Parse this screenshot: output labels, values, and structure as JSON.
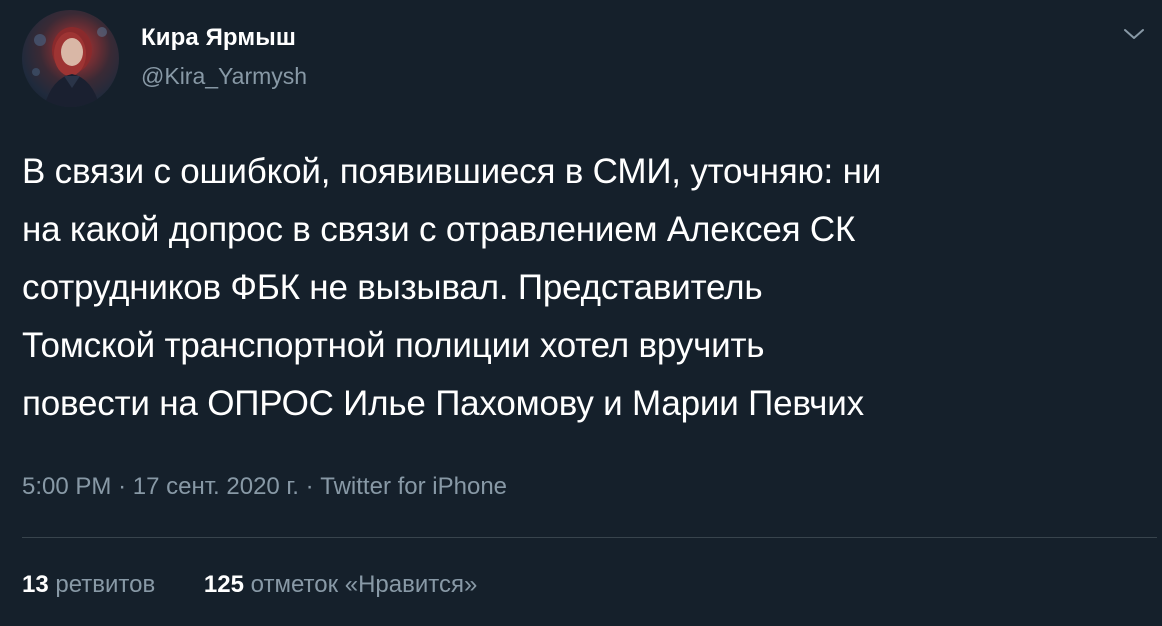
{
  "author": {
    "name": "Кира Ярмыш",
    "handle": "@Kira_Yarmysh"
  },
  "tweet": {
    "text": "В связи с ошибкой, появившиеся в СМИ, уточняю: ни\nна какой допрос в связи с отравлением Алексея СК\nсотрудников ФБК не вызывал. Представитель\nТомской транспортной полиции хотел вручить\nповести на ОПРОС Илье Пахомову и Марии Певчих",
    "time": "5:00 PM",
    "date": "17 сент. 2020 г.",
    "source": "Twitter for iPhone",
    "separator": "·"
  },
  "stats": {
    "retweets_count": "13",
    "retweets_label": "ретвитов",
    "likes_count": "125",
    "likes_label": "отметок «Нравится»"
  },
  "icons": {
    "menu": "chevron-down-icon"
  },
  "colors": {
    "background": "#15202b",
    "secondary_text": "#8899a6",
    "divider": "#38444d"
  }
}
